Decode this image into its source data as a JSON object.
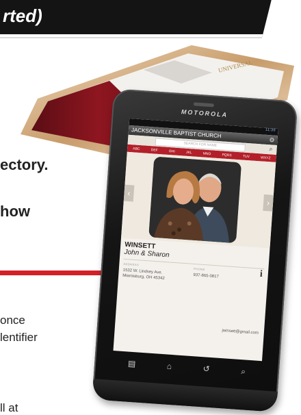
{
  "banner": {
    "text": "rted)"
  },
  "left_text": {
    "line1": "ectory.",
    "line2": "how",
    "line3": "once",
    "line4": "lentifier",
    "line5": "ll at"
  },
  "colors": {
    "accent_red": "#d42127",
    "banner_bg": "#141414"
  },
  "back_phone": {
    "logo_text": "UNIVERSAL"
  },
  "front_phone": {
    "brand": "MOTOROLA",
    "status_time": "11:39",
    "app_title": "JACKSONVILLE BAPTIST CHURCH",
    "search_placeholder": "SEARCH FOR NAME",
    "alpha_tabs": [
      "ABC",
      "DEF",
      "GHI",
      "JKL",
      "MNO",
      "PQRS",
      "TUV",
      "WXYZ"
    ],
    "entry": {
      "surname": "WINSETT",
      "first_names": "John & Sharon",
      "address_label": "ADDRESS",
      "address_line1": "1532 W. Lindsey Ave.",
      "address_line2": "Miamisburg, OH 45342",
      "phone_label": "PHONE",
      "phone": "937-865-0817",
      "email": "jwinsett@gmail.com"
    },
    "icons": [
      "gear-icon",
      "search-icon",
      "info-icon",
      "home-icon",
      "back-icon",
      "menu-icon"
    ]
  }
}
